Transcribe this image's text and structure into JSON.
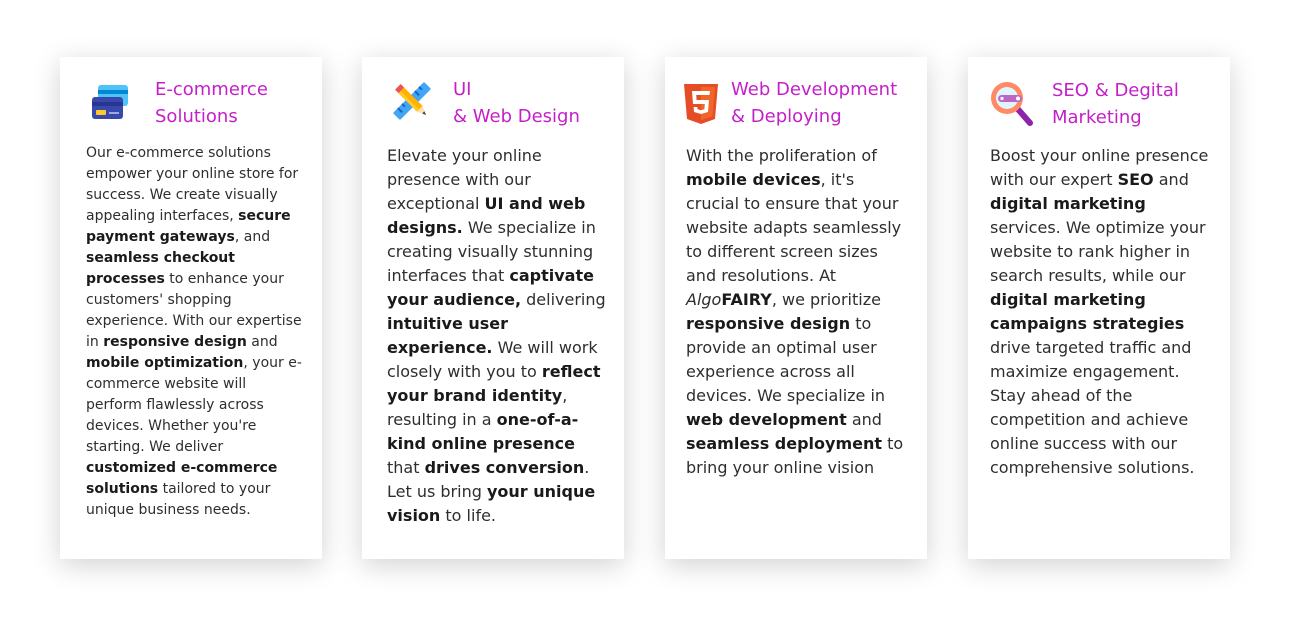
{
  "cards": [
    {
      "icon": "credit-card-icon",
      "title_line1": "E-commerce",
      "title_line2": "Solutions",
      "body": [
        {
          "t": "Our e-commerce solutions empower your online store for success. We create visually appealing interfaces, "
        },
        {
          "t": "secure payment gateways",
          "b": true
        },
        {
          "t": ", and "
        },
        {
          "t": "seamless checkout processes",
          "b": true
        },
        {
          "t": " to enhance your customers' shopping experience. With our expertise in "
        },
        {
          "t": "responsive design",
          "b": true
        },
        {
          "t": " and "
        },
        {
          "t": "mobile optimization",
          "b": true
        },
        {
          "t": ", your e-commerce website will perform flawlessly across devices. Whether you're starting. We deliver "
        },
        {
          "t": "customized e-commerce solutions",
          "b": true
        },
        {
          "t": " tailored to your unique business needs."
        }
      ]
    },
    {
      "icon": "design-tools-icon",
      "title_line1": "UI",
      "title_line2": "& Web Design",
      "body": [
        {
          "t": "Elevate your online presence with our exceptional "
        },
        {
          "t": "UI and web designs.",
          "b": true
        },
        {
          "t": " We specialize in creating visually stunning interfaces that "
        },
        {
          "t": "captivate your audience,",
          "b": true
        },
        {
          "t": " delivering "
        },
        {
          "t": "intuitive user experience.",
          "b": true
        },
        {
          "t": " We will work closely with you to "
        },
        {
          "t": "reflect your brand identity",
          "b": true
        },
        {
          "t": ", resulting in a "
        },
        {
          "t": "one-of-a-kind online presence",
          "b": true
        },
        {
          "t": " that "
        },
        {
          "t": "drives conversion",
          "b": true
        },
        {
          "t": ". Let us bring "
        },
        {
          "t": "your unique vision",
          "b": true
        },
        {
          "t": " to life."
        }
      ]
    },
    {
      "icon": "html5-icon",
      "title_line1": "Web Development",
      "title_line2": "& Deploying",
      "body": [
        {
          "t": "With the proliferation of "
        },
        {
          "t": "mobile devices",
          "b": true
        },
        {
          "t": ", it's crucial to ensure that your website adapts seamlessly to different screen sizes and resolutions. At "
        },
        {
          "t": "Algo",
          "i": true
        },
        {
          "t": "FAIRY",
          "b": true
        },
        {
          "t": ", we prioritize "
        },
        {
          "t": "responsive design",
          "b": true
        },
        {
          "t": " to provide an optimal user experience across all devices. We specialize in "
        },
        {
          "t": "web development",
          "b": true
        },
        {
          "t": " and "
        },
        {
          "t": "seamless deployment",
          "b": true
        },
        {
          "t": " to bring your online vision"
        }
      ]
    },
    {
      "icon": "seo-search-icon",
      "title_line1": "SEO & Degital",
      "title_line2": "Marketing",
      "body": [
        {
          "t": "Boost your online presence with our expert "
        },
        {
          "t": "SEO",
          "b": true
        },
        {
          "t": " and "
        },
        {
          "t": "digital marketing",
          "b": true
        },
        {
          "t": " services. We optimize your website to rank higher in search results, while our "
        },
        {
          "t": "digital marketing campaigns strategies",
          "b": true
        },
        {
          "t": " drive targeted traffic and maximize engagement. Stay ahead of the competition and achieve online success with our comprehensive solutions."
        }
      ]
    }
  ],
  "colors": {
    "title": "#c41fc9",
    "body_text": "#2e2e2e"
  }
}
